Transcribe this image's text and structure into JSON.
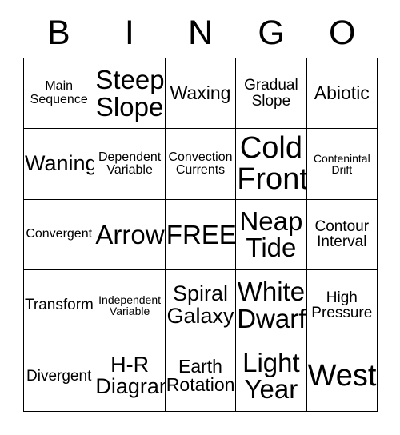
{
  "card": {
    "title": "BINGO",
    "headers": [
      "B",
      "I",
      "N",
      "G",
      "O"
    ],
    "free_space_label": "FREE!",
    "colors": {
      "background": "#ffffff",
      "text": "#000000",
      "border": "#000000"
    },
    "grid": {
      "columns": 5,
      "rows": 5
    },
    "cells": [
      [
        {
          "text": "Main\nSequence",
          "size": "sm"
        },
        {
          "text": "Steep\nSlope",
          "size": "xxl"
        },
        {
          "text": "Waxing",
          "size": "lg"
        },
        {
          "text": "Gradual\nSlope",
          "size": "md"
        },
        {
          "text": "Abiotic",
          "size": "lg"
        }
      ],
      [
        {
          "text": "Waning",
          "size": "xl"
        },
        {
          "text": "Dependent\nVariable",
          "size": "sm"
        },
        {
          "text": "Convection\nCurrents",
          "size": "sm"
        },
        {
          "text": "Cold\nFront",
          "size": "huge"
        },
        {
          "text": "Contenintal\nDrift",
          "size": "xs"
        }
      ],
      [
        {
          "text": "Convergent",
          "size": "sm"
        },
        {
          "text": "Arrow",
          "size": "xxl"
        },
        {
          "text": "FREE!",
          "size": "xxl"
        },
        {
          "text": "Neap\nTide",
          "size": "xxl"
        },
        {
          "text": "Contour\nInterval",
          "size": "md"
        }
      ],
      [
        {
          "text": "Transform",
          "size": "md"
        },
        {
          "text": "Independent\nVariable",
          "size": "xs"
        },
        {
          "text": "Spiral\nGalaxy",
          "size": "xl"
        },
        {
          "text": "White\nDwarf",
          "size": "xxl"
        },
        {
          "text": "High\nPressure",
          "size": "md"
        }
      ],
      [
        {
          "text": "Divergent",
          "size": "md"
        },
        {
          "text": "H-R\nDiagram",
          "size": "xl"
        },
        {
          "text": "Earth\nRotation",
          "size": "lg"
        },
        {
          "text": "Light\nYear",
          "size": "xxl"
        },
        {
          "text": "West",
          "size": "huge"
        }
      ]
    ]
  }
}
